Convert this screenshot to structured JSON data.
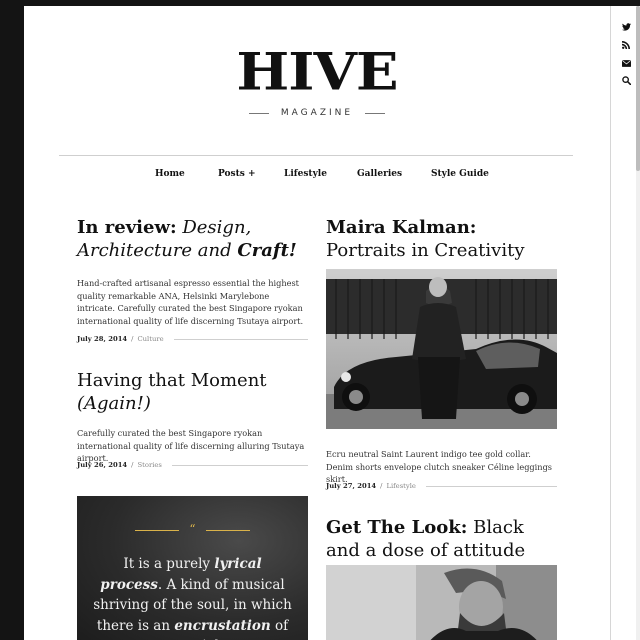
{
  "site": {
    "logo": "HIVE",
    "tagline": "MAGAZINE"
  },
  "nav": {
    "items": [
      {
        "label": "Home"
      },
      {
        "label": "Posts +"
      },
      {
        "label": "Lifestyle"
      },
      {
        "label": "Galleries"
      },
      {
        "label": "Style Guide"
      }
    ]
  },
  "rail": {
    "icons": [
      "twitter-icon",
      "rss-icon",
      "envelope-icon",
      "search-icon"
    ]
  },
  "articles": {
    "a1": {
      "title_bold": "In review:",
      "title_italic": "Design,",
      "title_line2a": "Architecture and",
      "title_line2b": "Craft!",
      "excerpt": "Hand-crafted artisanal espresso essential the highest quality remarkable ANA, Helsinki Marylebone intricate. Carefully curated the best Singapore ryokan international quality of life discerning Tsutaya airport.",
      "date": "July 28, 2014",
      "separator": "/",
      "category": "Culture"
    },
    "a2": {
      "title_line1": "Having that Moment",
      "title_line2": "(Again!)",
      "excerpt": "Carefully curated the best Singapore ryokan international quality of life discerning alluring Tsutaya airport.",
      "date": "July 26, 2014",
      "separator": "/",
      "category": "Stories"
    },
    "a3": {
      "title_bold": "Maira Kalman:",
      "title_rest": "Portraits in Creativity",
      "excerpt": "Ecru neutral Saint Laurent indigo tee gold collar. Denim shorts envelope clutch sneaker Céline leggings skirt.",
      "date": "July 27, 2014",
      "separator": "/",
      "category": "Lifestyle"
    },
    "a4": {
      "title_bold": "Get The Look:",
      "title_rest": "Black and a dose of attitude"
    }
  },
  "quote": {
    "mark": "“",
    "part1": "It is a purely ",
    "em1": "lyrical process",
    "part2": ". A kind of musical shriving of the soul, in which there is an ",
    "em2": "encrustation",
    "part3": " of material."
  },
  "colors": {
    "page_bg": "#ffffff",
    "outer_bg": "#141414",
    "quote_bg": "#2b2b2b",
    "accent": "#d9b24a"
  }
}
